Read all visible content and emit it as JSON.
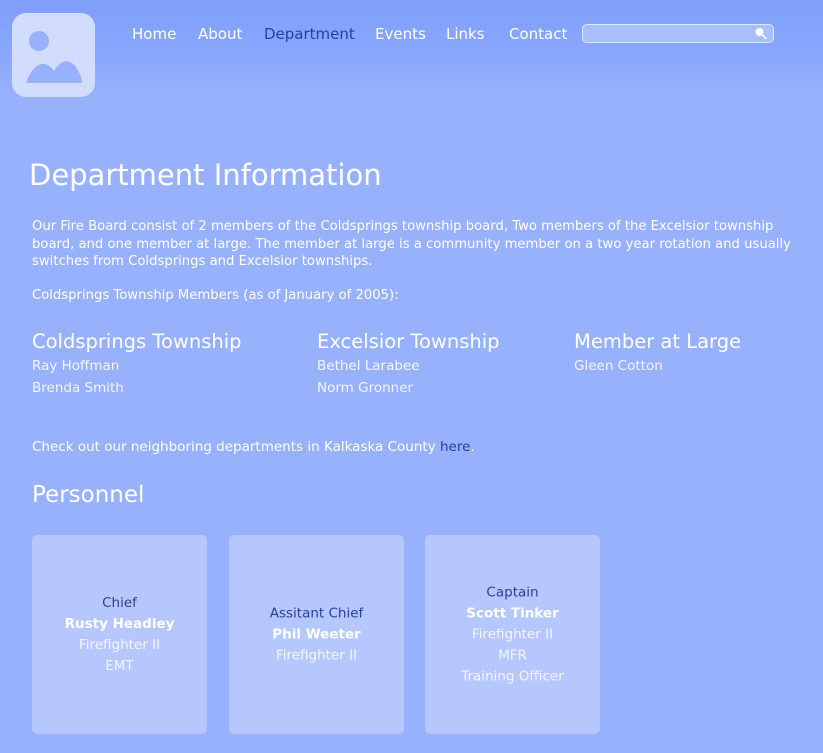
{
  "header": {
    "nav": [
      {
        "label": "Home",
        "active": false
      },
      {
        "label": "About",
        "active": false
      },
      {
        "label": "Department",
        "active": true
      },
      {
        "label": "Events",
        "active": false
      },
      {
        "label": "Links",
        "active": false
      },
      {
        "label": "Contact",
        "active": false
      }
    ],
    "search": {
      "placeholder": "",
      "value": ""
    },
    "logo_icon": "image-placeholder-icon"
  },
  "main": {
    "title": "Department Information",
    "intro": "Our Fire Board consist of 2 members of the Coldsprings township board, Two members of the Excelsior township board, and one member at large.  The member at large is a community member on a two year rotation and usually switches from Coldsprings and Excelsior townships.",
    "as_of": "Coldsprings Township Members (as of January of 2005):",
    "columns": [
      {
        "heading": "Coldsprings Township",
        "members": [
          "Ray Hoffman",
          "Brenda Smith"
        ]
      },
      {
        "heading": "Excelsior Township",
        "members": [
          "Bethel Larabee",
          "Norm Gronner"
        ]
      },
      {
        "heading": "Member at Large",
        "members": [
          "Gleen Cotton"
        ]
      }
    ],
    "neighbor_text": "Check out our neighboring departments in Kalkaska County ",
    "neighbor_link": "here",
    "neighbor_end": ".",
    "personnel_heading": "Personnel",
    "personnel": [
      {
        "title": "Chief",
        "name": "Rusty Headley",
        "quals": [
          "Firefighter II",
          "EMT"
        ]
      },
      {
        "title": "Assitant Chief",
        "name": "Phil Weeter",
        "quals": [
          "Firefighter II"
        ]
      },
      {
        "title": "Captain",
        "name": "Scott Tinker",
        "quals": [
          "Firefighter II",
          "MFR",
          "Training Officer"
        ]
      }
    ]
  },
  "colors": {
    "background": "#97b1fd",
    "card": "#b5c7fd",
    "accent_text": "#2a3f9a",
    "logo_bg": "#d2dcfd"
  }
}
